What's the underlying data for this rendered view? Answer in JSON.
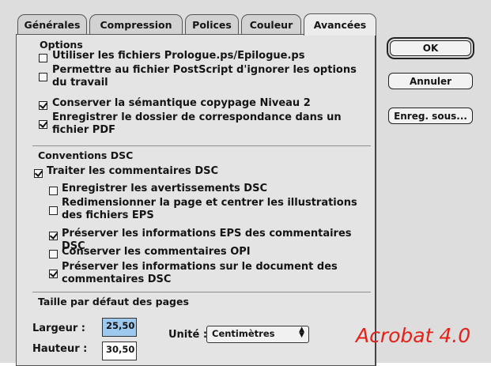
{
  "tabs": [
    "Générales",
    "Compression",
    "Polices",
    "Couleur",
    "Avancées"
  ],
  "options": {
    "title": "Options",
    "items": [
      {
        "line1": "Utiliser les fichiers Prologue.ps/Epilogue.ps",
        "line2": "",
        "checked": false
      },
      {
        "line1": "Permettre au fichier PostScript d'ignorer les options",
        "line2": "du travail",
        "checked": false
      },
      {
        "line1": "Conserver la sémantique copypage Niveau 2",
        "line2": "",
        "checked": true
      },
      {
        "line1": "Enregistrer le dossier de correspondance dans un",
        "line2": "fichier PDF",
        "checked": true
      }
    ]
  },
  "dsc": {
    "title": "Conventions DSC",
    "main": {
      "label": "Traiter les commentaires DSC",
      "checked": true
    },
    "items": [
      {
        "line1": "Enregistrer les avertissements DSC",
        "line2": "",
        "checked": false
      },
      {
        "line1": "Redimensionner la page et centrer les illustrations",
        "line2": "des fichiers EPS",
        "checked": false
      },
      {
        "line1": "Préserver les informations EPS des commentaires DSC",
        "line2": "",
        "checked": true
      },
      {
        "line1": "Conserver les commentaires OPI",
        "line2": "",
        "checked": false
      },
      {
        "line1": "Préserver les informations sur le document des",
        "line2": "commentaires DSC",
        "checked": true
      }
    ]
  },
  "page_size": {
    "title": "Taille par défaut des pages",
    "width_label": "Largeur :",
    "width_value": "25,50",
    "height_label": "Hauteur :",
    "height_value": "30,50",
    "unit_label": "Unité :",
    "unit_value": "Centimètres"
  },
  "buttons": {
    "ok": "OK",
    "cancel": "Annuler",
    "save_as": "Enreg. sous..."
  },
  "watermark": "Acrobat 4.0"
}
